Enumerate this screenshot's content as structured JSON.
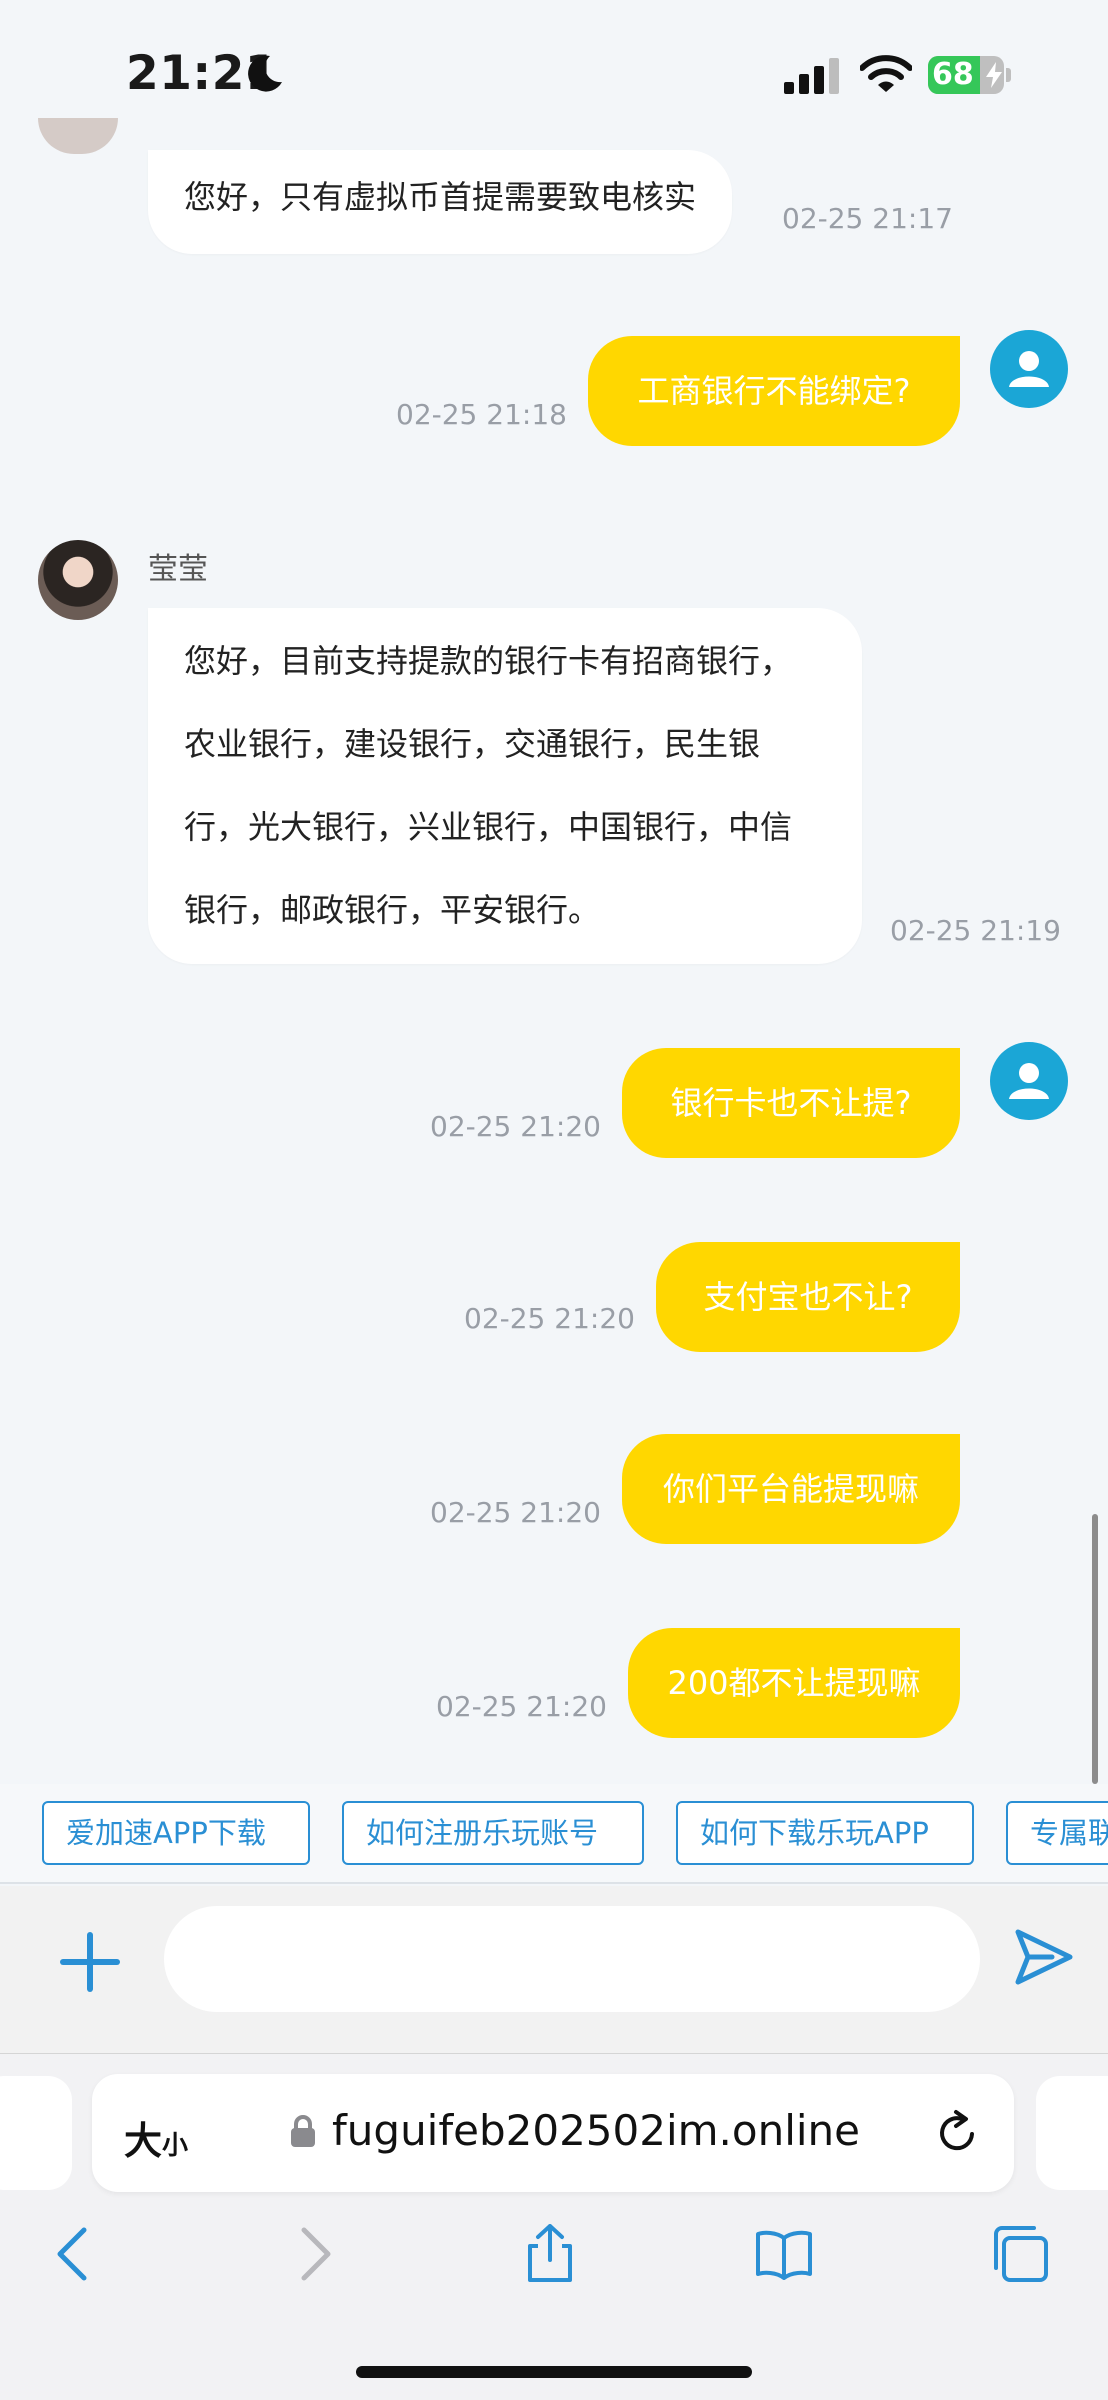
{
  "status_bar": {
    "time": "21:21",
    "battery_level": "68",
    "battery_fraction": 0.68
  },
  "chat": {
    "agent_name": "莹莹",
    "messages": [
      {
        "direction": "in",
        "text": "您好，只有虚拟币首提需要致电核实",
        "time": "02-25 21:17"
      },
      {
        "direction": "out",
        "text": "工商银行不能绑定?",
        "time": "02-25 21:18"
      },
      {
        "direction": "in",
        "sender": "莹莹",
        "lines": [
          "您好，目前支持提款的银行卡有招商银行，",
          "农业银行，建设银行，交通银行，民生银",
          "行，光大银行，兴业银行，中国银行，中信",
          "银行，邮政银行，平安银行。"
        ],
        "time": "02-25 21:19"
      },
      {
        "direction": "out",
        "text": "银行卡也不让提?",
        "time": "02-25 21:20"
      },
      {
        "direction": "out",
        "text": "支付宝也不让?",
        "time": "02-25 21:20"
      },
      {
        "direction": "out",
        "text": "你们平台能提现嘛",
        "time": "02-25 21:20"
      },
      {
        "direction": "out",
        "text": "200都不让提现嘛",
        "time": "02-25 21:20"
      }
    ]
  },
  "quick_replies": [
    "爱加速APP下载",
    "如何注册乐玩账号",
    "如何下载乐玩APP",
    "专属联"
  ],
  "composer": {
    "placeholder": "",
    "add_icon": "plus-icon",
    "send_icon": "send-icon"
  },
  "browser": {
    "text_size_big": "大",
    "text_size_small": "小",
    "url": "fuguifeb202502im.online",
    "nav_icons": [
      "back-icon",
      "forward-icon",
      "share-icon",
      "bookmarks-icon",
      "tabs-icon"
    ]
  },
  "colors": {
    "outgoing_bubble": "#ffd700",
    "incoming_bubble": "#ffffff",
    "user_avatar": "#1ba6d6",
    "accent": "#2a8fd4",
    "background": "#f3f6f9"
  }
}
